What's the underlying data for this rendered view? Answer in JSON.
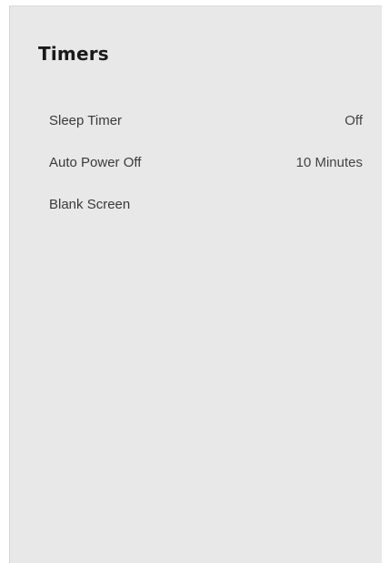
{
  "page": {
    "title": "Timers"
  },
  "menu": {
    "items": [
      {
        "label": "Sleep Timer",
        "value": "Off"
      },
      {
        "label": "Auto Power Off",
        "value": "10 Minutes"
      },
      {
        "label": "Blank Screen",
        "value": ""
      }
    ]
  }
}
